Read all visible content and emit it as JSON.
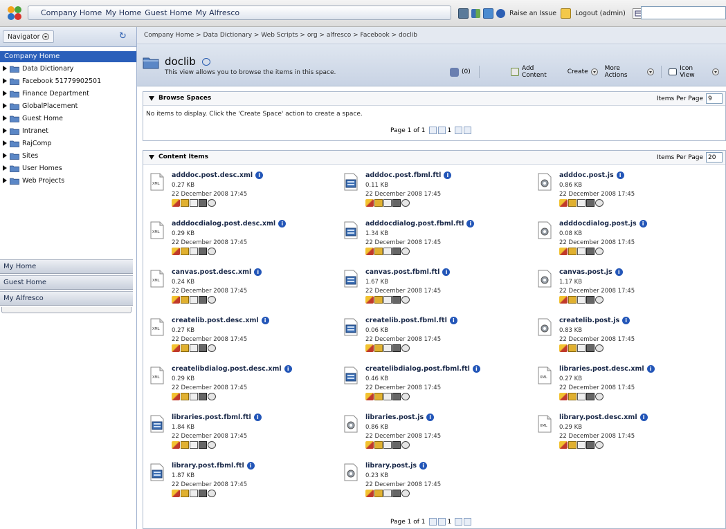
{
  "topbar": {
    "links": [
      "Company Home",
      "My Home",
      "Guest Home",
      "My Alfresco"
    ],
    "raise_issue": "Raise an Issue",
    "logout": "Logout (admin)",
    "search_value": ""
  },
  "sidebar": {
    "navigator_label": "Navigator",
    "tree_title": "Company Home",
    "items": [
      "Data Dictionary",
      "Facebook 51779902501",
      "Finance Department",
      "GlobalPlacement",
      "Guest Home",
      "Intranet",
      "RajComp",
      "Sites",
      "User Homes",
      "Web Projects"
    ],
    "bottom_nav": [
      "My Home",
      "Guest Home",
      "My Alfresco"
    ]
  },
  "main": {
    "breadcrumb": "Company Home > Data Dictionary > Web Scripts > org > alfresco > Facebook > doclib",
    "space_title": "doclib",
    "space_desc": "This view allows you to browse the items in this space.",
    "rss_count": "(0)",
    "actions": {
      "add_content": "Add Content",
      "create": "Create",
      "more_actions": "More Actions",
      "icon_view": "Icon View"
    }
  },
  "browse_spaces": {
    "title": "Browse Spaces",
    "items_per_page_label": "Items Per Page",
    "items_per_page": "9",
    "empty_text": "No items to display. Click the 'Create Space' action to create a space.",
    "pager_text": "Page 1 of 1",
    "pager_current": "1"
  },
  "content_items": {
    "title": "Content Items",
    "items_per_page_label": "Items Per Page",
    "items_per_page": "20",
    "pager_text": "Page 1 of 1",
    "pager_current": "1",
    "items": [
      {
        "name": "adddoc.post.desc.xml",
        "size": "0.27 KB",
        "date": "22 December 2008 17:45",
        "type": "xml"
      },
      {
        "name": "adddoc.post.fbml.ftl",
        "size": "0.11 KB",
        "date": "22 December 2008 17:45",
        "type": "ftl"
      },
      {
        "name": "adddoc.post.js",
        "size": "0.86 KB",
        "date": "22 December 2008 17:45",
        "type": "js"
      },
      {
        "name": "adddocdialog.post.desc.xml",
        "size": "0.29 KB",
        "date": "22 December 2008 17:45",
        "type": "xml"
      },
      {
        "name": "adddocdialog.post.fbml.ftl",
        "size": "1.34 KB",
        "date": "22 December 2008 17:45",
        "type": "ftl"
      },
      {
        "name": "adddocdialog.post.js",
        "size": "0.08 KB",
        "date": "22 December 2008 17:45",
        "type": "js"
      },
      {
        "name": "canvas.post.desc.xml",
        "size": "0.24 KB",
        "date": "22 December 2008 17:45",
        "type": "xml"
      },
      {
        "name": "canvas.post.fbml.ftl",
        "size": "1.67 KB",
        "date": "22 December 2008 17:45",
        "type": "ftl"
      },
      {
        "name": "canvas.post.js",
        "size": "1.17 KB",
        "date": "22 December 2008 17:45",
        "type": "js"
      },
      {
        "name": "createlib.post.desc.xml",
        "size": "0.27 KB",
        "date": "22 December 2008 17:45",
        "type": "xml"
      },
      {
        "name": "createlib.post.fbml.ftl",
        "size": "0.06 KB",
        "date": "22 December 2008 17:45",
        "type": "ftl"
      },
      {
        "name": "createlib.post.js",
        "size": "0.83 KB",
        "date": "22 December 2008 17:45",
        "type": "js"
      },
      {
        "name": "createlibdialog.post.desc.xml",
        "size": "0.29 KB",
        "date": "22 December 2008 17:45",
        "type": "xml"
      },
      {
        "name": "createlibdialog.post.fbml.ftl",
        "size": "0.46 KB",
        "date": "22 December 2008 17:45",
        "type": "ftl"
      },
      {
        "name": "libraries.post.desc.xml",
        "size": "0.27 KB",
        "date": "22 December 2008 17:45",
        "type": "xml"
      },
      {
        "name": "libraries.post.fbml.ftl",
        "size": "1.84 KB",
        "date": "22 December 2008 17:45",
        "type": "ftl"
      },
      {
        "name": "libraries.post.js",
        "size": "0.86 KB",
        "date": "22 December 2008 17:45",
        "type": "js"
      },
      {
        "name": "library.post.desc.xml",
        "size": "0.29 KB",
        "date": "22 December 2008 17:45",
        "type": "xml"
      },
      {
        "name": "library.post.fbml.ftl",
        "size": "1.87 KB",
        "date": "22 December 2008 17:45",
        "type": "ftl"
      },
      {
        "name": "library.post.js",
        "size": "0.23 KB",
        "date": "22 December 2008 17:45",
        "type": "js"
      }
    ]
  }
}
